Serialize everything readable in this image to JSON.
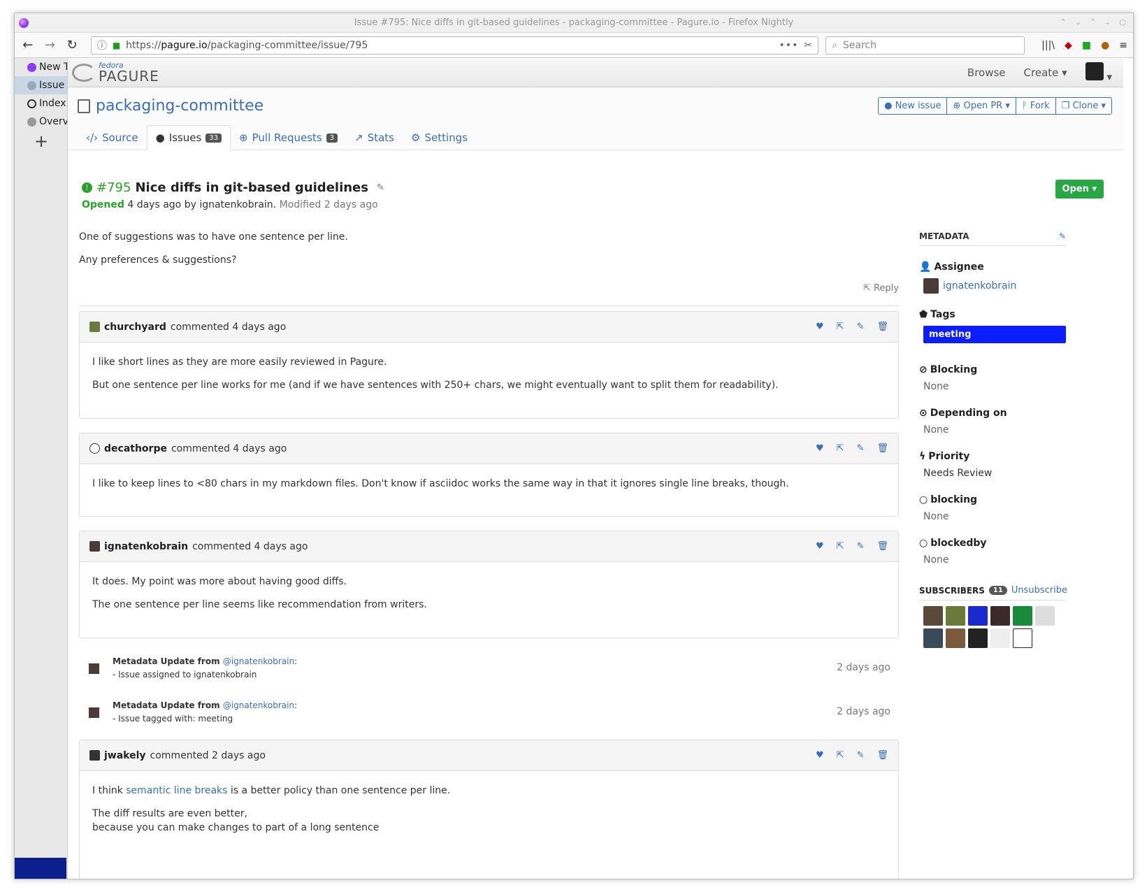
{
  "window": {
    "title": "Issue #795: Nice diffs in git-based guidelines - packaging-committee - Pagure.io - Firefox Nightly"
  },
  "browser": {
    "url_prefix": "https://",
    "url_host": "pagure.io",
    "url_path": "/packaging-committee/issue/795",
    "url_more": "•••",
    "search_placeholder": "Search"
  },
  "sidebar": {
    "items": [
      {
        "label": "New T"
      },
      {
        "label": "Issue"
      },
      {
        "label": "Index"
      },
      {
        "label": "Overv"
      }
    ],
    "add": "+"
  },
  "pagure": {
    "logo_small": "fedora",
    "logo_big": "PAGURE",
    "nav": {
      "browse": "Browse",
      "create": "Create ▾"
    }
  },
  "repo": {
    "name": "packaging-committee",
    "buttons": {
      "new_issue": "New issue",
      "open_pr": "Open PR ▾",
      "fork": "Fork",
      "clone": "Clone ▾"
    },
    "tabs": [
      {
        "label": "Source"
      },
      {
        "label": "Issues",
        "badge": "33"
      },
      {
        "label": "Pull Requests",
        "badge": "3"
      },
      {
        "label": "Stats"
      },
      {
        "label": "Settings"
      }
    ]
  },
  "issue": {
    "number": "#795",
    "title": "Nice diffs in git-based guidelines",
    "opened": "Opened",
    "opened_rest": " 4 days ago by ignatenkobrain.",
    "modified": " Modified 2 days ago",
    "status": "Open ▾",
    "description": [
      "One of suggestions was to have one sentence per line.",
      "Any preferences & suggestions?"
    ],
    "reply": "Reply"
  },
  "comments": [
    {
      "user": "churchyard",
      "ago": "commented 4 days ago",
      "body": [
        "I like short lines as they are more easily reviewed in Pagure.",
        "But one sentence per line works for me (and if we have sentences with 250+ chars, we might eventually want to split them for readability)."
      ]
    },
    {
      "user": "decathorpe",
      "ago": "commented 4 days ago",
      "body": [
        "I like to keep lines to <80 chars in my markdown files. Don't know if asciidoc works the same way in that it ignores single line breaks, though."
      ]
    },
    {
      "user": "ignatenkobrain",
      "ago": "commented 4 days ago",
      "body": [
        "It does. My point was more about having good diffs.",
        "The one sentence per line seems like recommendation from writers."
      ]
    },
    {
      "user": "jwakely",
      "ago": "commented 2 days ago",
      "body_pre": "I think ",
      "body_link": "semantic line breaks",
      "body_post": " is a better policy than one sentence per line.",
      "body2a": "The diff results are even better,",
      "body2b": "because you can make changes to part of a long sentence"
    }
  ],
  "updates": [
    {
      "label": "Metadata Update from ",
      "who": "@ignatenkobrain",
      "colon": ":",
      "detail": "- Issue assigned to ignatenkobrain",
      "when": "2 days ago"
    },
    {
      "label": "Metadata Update from ",
      "who": "@ignatenkobrain",
      "colon": ":",
      "detail": "- Issue tagged with: meeting",
      "when": "2 days ago"
    }
  ],
  "metadata": {
    "heading": "METADATA",
    "assignee_label": "Assignee",
    "assignee": "ignatenkobrain",
    "tags_label": "Tags",
    "tag": "meeting",
    "blocking_label": "Blocking",
    "blocking": "None",
    "depending_label": "Depending on",
    "depending": "None",
    "priority_label": "Priority",
    "priority": "Needs Review",
    "blocking2_label": "blocking",
    "blocking2": "None",
    "blockedby_label": "blockedby",
    "blockedby": "None",
    "subscribers_label": "SUBSCRIBERS",
    "subscribers_count": "11",
    "unsubscribe": "Unsubscribe"
  },
  "colors": {
    "accent": "#3c6eb4",
    "open": "#28a745",
    "tag": "#0a1eff"
  }
}
